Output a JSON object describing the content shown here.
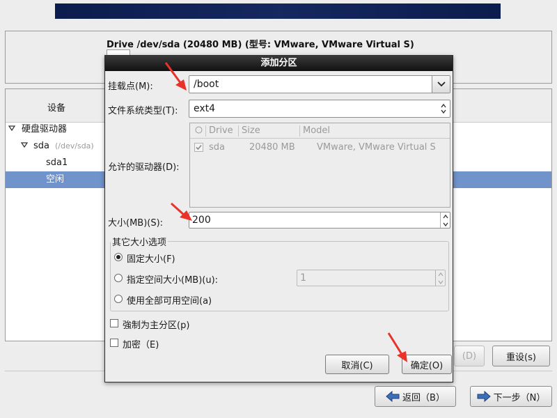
{
  "drive": {
    "title": "Drive /dev/sda (20480 MB) (型号: VMware, VMware Virtual S)"
  },
  "tree": {
    "header": "设备",
    "rows": [
      {
        "label": "硬盘驱动器",
        "sub": ""
      },
      {
        "label": "sda",
        "sub": "(/dev/sda)"
      },
      {
        "label": "sda1",
        "sub": ""
      },
      {
        "label": "空闲",
        "sub": ""
      }
    ]
  },
  "background_buttons": {
    "delete": "(D)",
    "reset": "重设(s)",
    "back": "返回（B）",
    "next": "下一步（N）"
  },
  "dialog": {
    "title": "添加分区",
    "mount_label": "挂载点(M):",
    "mount_value": "/boot",
    "fstype_label": "文件系统类型(T):",
    "fstype_value": "ext4",
    "allowed_label": "允许的驱动器(D):",
    "drive_table": {
      "columns": [
        "Drive",
        "Size",
        "Model"
      ],
      "rows": [
        {
          "drive": "sda",
          "size": "20480 MB",
          "model": "VMware, VMware Virtual S",
          "checked": true
        }
      ]
    },
    "size_label": "大小(MB)(S):",
    "size_value": "200",
    "other_options_title": "其它大小选项",
    "options": [
      {
        "label": "固定大小(F)",
        "selected": true
      },
      {
        "label": "指定空间大小(MB)(u):",
        "selected": false
      },
      {
        "label": "使用全部可用空间(a)",
        "selected": false
      }
    ],
    "max_size_value": "1",
    "force_primary_label": "強制为主分区(p)",
    "encrypt_label": "加密（E)",
    "cancel_label": "取消(C)",
    "ok_label": "确定(O)"
  },
  "colors": {
    "selection": "#7093cc",
    "banner": "#0b1c4d",
    "arrow": "#e8322a"
  }
}
